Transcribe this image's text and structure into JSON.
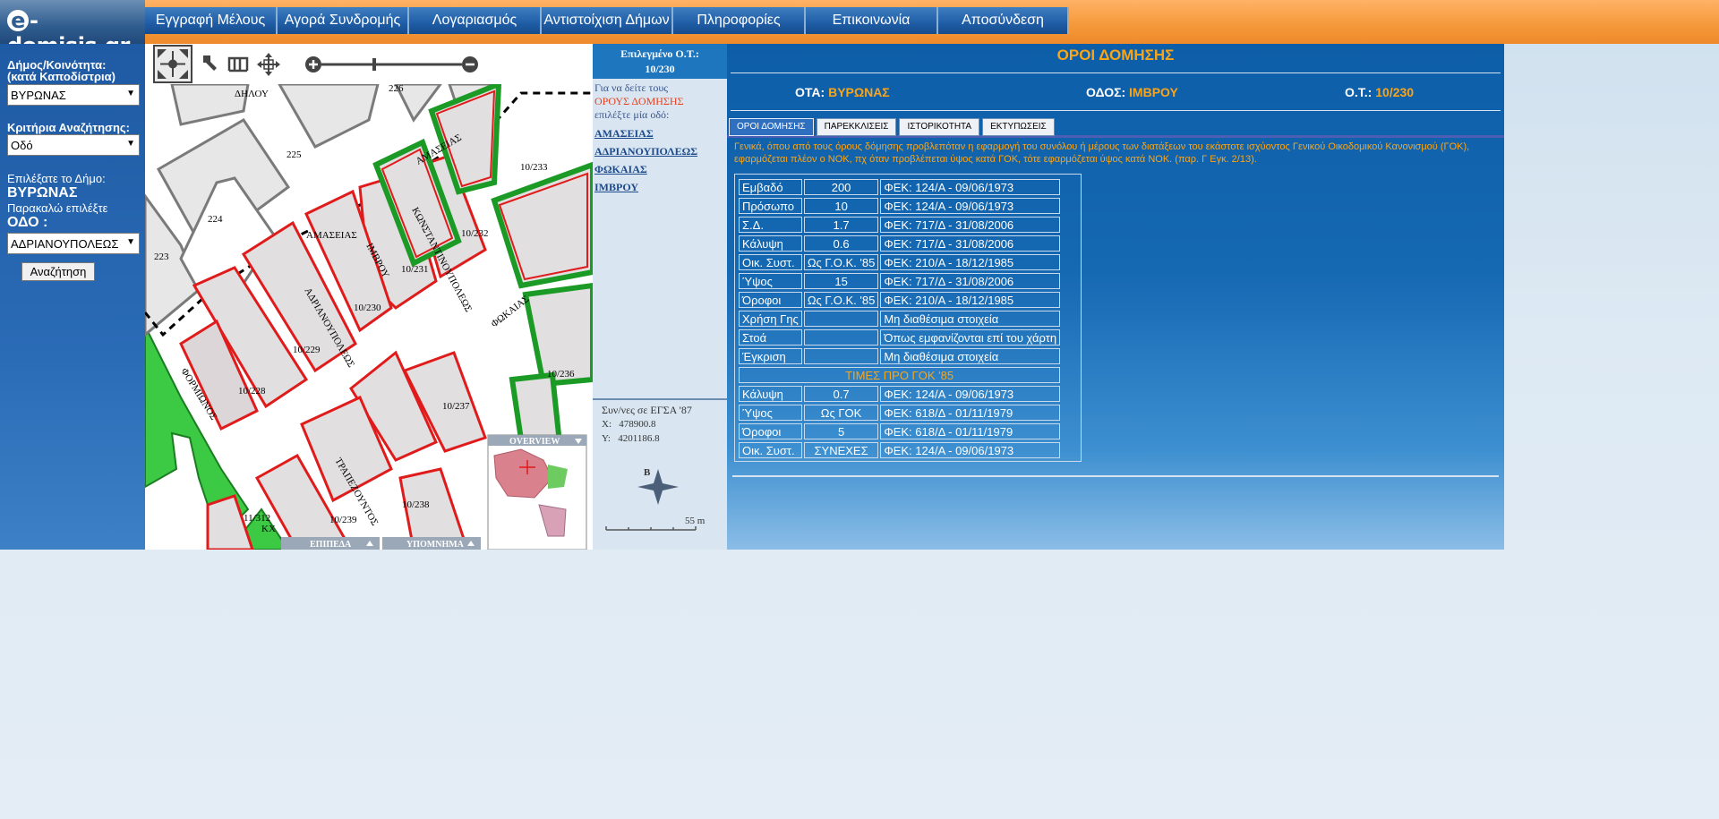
{
  "logo": {
    "e": "e",
    "rest": "-domisis.gr"
  },
  "nav": [
    {
      "label": "Εγγραφή Μέλους",
      "w": 148
    },
    {
      "label": "Αγορά Συνδρομής",
      "w": 147
    },
    {
      "label": "Λογαριασμός",
      "w": 148
    },
    {
      "label": "Αντιστοίχιση Δήμων",
      "w": 147
    },
    {
      "label": "Πληροφορίες",
      "w": 148
    },
    {
      "label": "Επικοινωνία",
      "w": 148
    },
    {
      "label": "Αποσύνδεση",
      "w": 146
    }
  ],
  "left": {
    "municipality_label_1": "Δήμος/Κοινότητα:",
    "municipality_label_2": "(κατά Καποδίστρια)",
    "municipality_value": "ΒΥΡΩΝΑΣ",
    "criteria_label": "Κριτήρια Αναζήτησης:",
    "criteria_value": "Οδό",
    "choose_municipality": "Επιλέξατε το Δήμο:",
    "chosen_municipality": "ΒΥΡΩΝΑΣ",
    "please_choose": "Παρακαλώ επιλέξτε",
    "street_label": "ΟΔΟ :",
    "street_value": "ΑΔΡΙΑΝΟΥΠΟΛΕΩΣ",
    "search_button": "Αναζήτηση"
  },
  "map": {
    "streets": [
      "ΔΗΛΟΥ",
      "ΑΜΑΣΕΙΑΣ",
      "ΑΜΑΣΕΙΑΣ",
      "ΙΜΒΡΟΥ",
      "ΚΩΝΣΤΑΝΤΙΝΟΥΠΟΛΕΩΣ",
      "ΦΩΚΑΙΑΣ",
      "ΑΔΡΙΑΝΟΥΠΟΛΕΩΣ",
      "ΦΟΡΜΙΩΝΟΣ",
      "ΤΡΑΠΕΖΟΥΝΤΟΣ"
    ],
    "blocks": [
      "226",
      "225",
      "224",
      "223",
      "10/233",
      "10/232",
      "10/231",
      "10/230",
      "10/229",
      "10/228",
      "10/237",
      "10/236",
      "10/238",
      "10/239",
      "11/312",
      "ΚΧ"
    ],
    "overview_label": "OVERVIEW",
    "legend_tabs": [
      "ΕΠΙΠΕΔΑ",
      "ΥΠΟΜΝΗΜΑ"
    ]
  },
  "mid": {
    "selected_label": "Επιλεγμένο Ο.Τ.:",
    "selected_value": "10/230",
    "info_1": "Για να δείτε τους",
    "info_2": "ΟΡΟΥΣ ΔΟΜΗΣΗΣ",
    "info_3": "επιλέξτε μία οδό:",
    "streets": [
      "ΑΜΑΣΕΙΑΣ",
      "ΑΔΡΙΑΝΟΥΠΟΛΕΩΣ",
      "ΦΩΚΑΙΑΣ",
      "ΙΜΒΡΟΥ"
    ],
    "coords_label": "Συν/νες σε ΕΓΣΑ '87",
    "x_label": "X:",
    "x_value": "478900.8",
    "y_label": "Y:",
    "y_value": "4201186.8",
    "compass": "Β",
    "scale": "55 m"
  },
  "right": {
    "title": "ΟΡΟΙ ΔΟΜΗΣΗΣ",
    "ota_label": "ΟΤΑ:",
    "ota_value": "ΒΥΡΩΝΑΣ",
    "street_label": "ΟΔΟΣ:",
    "street_value": "ΙΜΒΡΟΥ",
    "ot_label": "Ο.Τ.:",
    "ot_value": "10/230",
    "tabs": [
      "ΟΡΟΙ ΔΟΜΗΣΗΣ",
      "ΠΑΡΕΚΚΛΙΣΕΙΣ",
      "ΙΣΤΟΡΙΚΟΤΗΤΑ",
      "ΕΚΤΥΠΩΣΕΙΣ"
    ],
    "note": "Γενικά, όπου από τους όρους δόμησης προβλεπόταν η εφαρμογή του συνόλου ή μέρους των διατάξεων του εκάστοτε ισχύοντος Γενικού Οικοδομικού Κανονισμού (ΓΟΚ), εφαρμόζεται πλέον ο ΝΟΚ, πχ όταν προβλέπεται ύψος κατά ΓΟΚ, τότε εφαρμόζεται ύψος κατά ΝΟΚ. (παρ. Γ Εγκ. 2/13).",
    "rows": [
      [
        "Εμβαδό",
        "200",
        "ΦΕΚ: 124/Α - 09/06/1973"
      ],
      [
        "Πρόσωπο",
        "10",
        "ΦΕΚ: 124/Α - 09/06/1973"
      ],
      [
        "Σ.Δ.",
        "1.7",
        "ΦΕΚ: 717/Δ - 31/08/2006"
      ],
      [
        "Κάλυψη",
        "0.6",
        "ΦΕΚ: 717/Δ - 31/08/2006"
      ],
      [
        "Οικ. Συστ.",
        "Ως Γ.Ο.Κ. '85",
        "ΦΕΚ: 210/Α - 18/12/1985"
      ],
      [
        "Ύψος",
        "15",
        "ΦΕΚ: 717/Δ - 31/08/2006"
      ],
      [
        "Όροφοι",
        "Ως Γ.Ο.Κ. '85",
        "ΦΕΚ: 210/Α - 18/12/1985"
      ],
      [
        "Χρήση Γης",
        "",
        "Μη διαθέσιμα στοιχεία"
      ],
      [
        "Στοά",
        "",
        "Όπως εμφανίζονται επί του χάρτη"
      ],
      [
        "Έγκριση",
        "",
        "Μη διαθέσιμα στοιχεία"
      ]
    ],
    "sub_header": "ΤΙΜΕΣ ΠΡΟ ΓΟΚ '85",
    "rows2": [
      [
        "Κάλυψη",
        "0.7",
        "ΦΕΚ: 124/Α - 09/06/1973"
      ],
      [
        "Ύψος",
        "Ως ΓΟΚ",
        "ΦΕΚ: 618/Δ - 01/11/1979"
      ],
      [
        "Όροφοι",
        "5",
        "ΦΕΚ: 618/Δ - 01/11/1979"
      ],
      [
        "Οικ. Συστ.",
        "ΣΥΝΕΧΕΣ",
        "ΦΕΚ: 124/Α - 09/06/1973"
      ]
    ]
  }
}
